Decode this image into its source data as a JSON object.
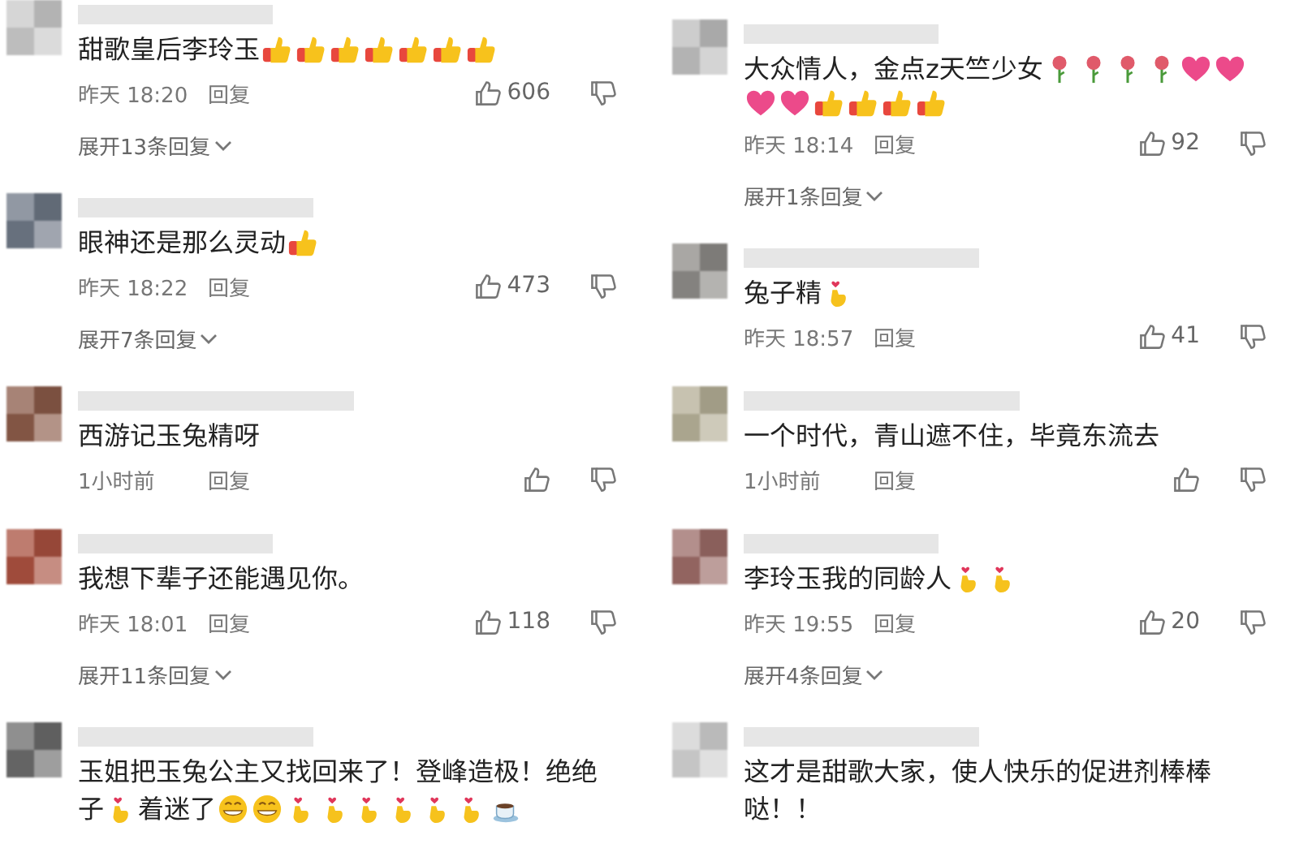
{
  "columns": [
    {
      "comments": [
        {
          "color": "#c8c8c8",
          "lines": [
            [
              {
                "kind": "text",
                "text": "甜歌皇后李玲玉"
              },
              {
                "kind": "thumbs-up"
              },
              {
                "kind": "thumbs-up"
              },
              {
                "kind": "thumbs-up"
              },
              {
                "kind": "thumbs-up"
              },
              {
                "kind": "thumbs-up"
              },
              {
                "kind": "thumbs-up"
              },
              {
                "kind": "thumbs-up"
              }
            ]
          ],
          "time": "昨天 18:20",
          "reply": "回复",
          "likes": "606",
          "replies": "展开13条回复"
        },
        {
          "color": "#6d7684",
          "lines": [
            [
              {
                "kind": "text",
                "text": "眼神还是那么灵动"
              },
              {
                "kind": "thumbs-up"
              }
            ]
          ],
          "time": "昨天 18:22",
          "reply": "回复",
          "likes": "473",
          "replies": "展开7条回复"
        },
        {
          "color": "#8a5a48",
          "lines": [
            [
              {
                "kind": "text",
                "text": "西游记玉兔精呀"
              }
            ]
          ],
          "time": "1小时前",
          "reply": "回复"
        },
        {
          "color": "#a8503f",
          "lines": [
            [
              {
                "kind": "text",
                "text": "我想下辈子还能遇见你。"
              }
            ]
          ],
          "time": "昨天 18:01",
          "reply": "回复",
          "likes": "118",
          "replies": "展开11条回复"
        },
        {
          "color": "#6a6a6a",
          "lines": [
            [
              {
                "kind": "text",
                "text": "玉姐把玉兔公主又找回来了！登峰造极！绝绝"
              }
            ],
            [
              {
                "kind": "text",
                "text": "子"
              },
              {
                "kind": "finger-heart"
              },
              {
                "kind": "text",
                "text": "着迷了"
              },
              {
                "kind": "grin"
              },
              {
                "kind": "grin"
              },
              {
                "kind": "finger-heart"
              },
              {
                "kind": "finger-heart"
              },
              {
                "kind": "finger-heart"
              },
              {
                "kind": "finger-heart"
              },
              {
                "kind": "finger-heart"
              },
              {
                "kind": "finger-heart"
              },
              {
                "kind": "coffee"
              }
            ]
          ]
        }
      ]
    },
    {
      "comments": [
        {
          "color": "#bdbdbd",
          "lines": [
            [
              {
                "kind": "text",
                "text": "大众情人，金点z天竺少女"
              },
              {
                "kind": "rose"
              },
              {
                "kind": "rose"
              },
              {
                "kind": "rose"
              },
              {
                "kind": "rose"
              },
              {
                "kind": "heart"
              },
              {
                "kind": "heart"
              }
            ],
            [
              {
                "kind": "heart"
              },
              {
                "kind": "heart"
              },
              {
                "kind": "thumbs-up"
              },
              {
                "kind": "thumbs-up"
              },
              {
                "kind": "thumbs-up"
              },
              {
                "kind": "thumbs-up"
              }
            ]
          ],
          "time": "昨天 18:14",
          "reply": "回复",
          "likes": "92",
          "replies": "展开1条回复"
        },
        {
          "color": "#8c8a86",
          "lines": [
            [
              {
                "kind": "text",
                "text": "兔子精"
              },
              {
                "kind": "finger-heart"
              }
            ]
          ],
          "time": "昨天 18:57",
          "reply": "回复",
          "likes": "41"
        },
        {
          "color": "#b4ae96",
          "lines": [
            [
              {
                "kind": "text",
                "text": "一个时代，青山遮不住，毕竟东流去"
              }
            ]
          ],
          "time": "1小时前",
          "reply": "回复"
        },
        {
          "color": "#9a6a66",
          "lines": [
            [
              {
                "kind": "text",
                "text": "李玲玉我的同龄人"
              },
              {
                "kind": "finger-heart"
              },
              {
                "kind": "finger-heart"
              }
            ]
          ],
          "time": "昨天 19:55",
          "reply": "回复",
          "likes": "20",
          "replies": "展开4条回复"
        },
        {
          "color": "#d0d0d0",
          "lines": [
            [
              {
                "kind": "text",
                "text": "这才是甜歌大家，使人快乐的促进剂棒棒"
              }
            ],
            [
              {
                "kind": "text",
                "text": "哒！！"
              }
            ]
          ]
        }
      ]
    }
  ]
}
